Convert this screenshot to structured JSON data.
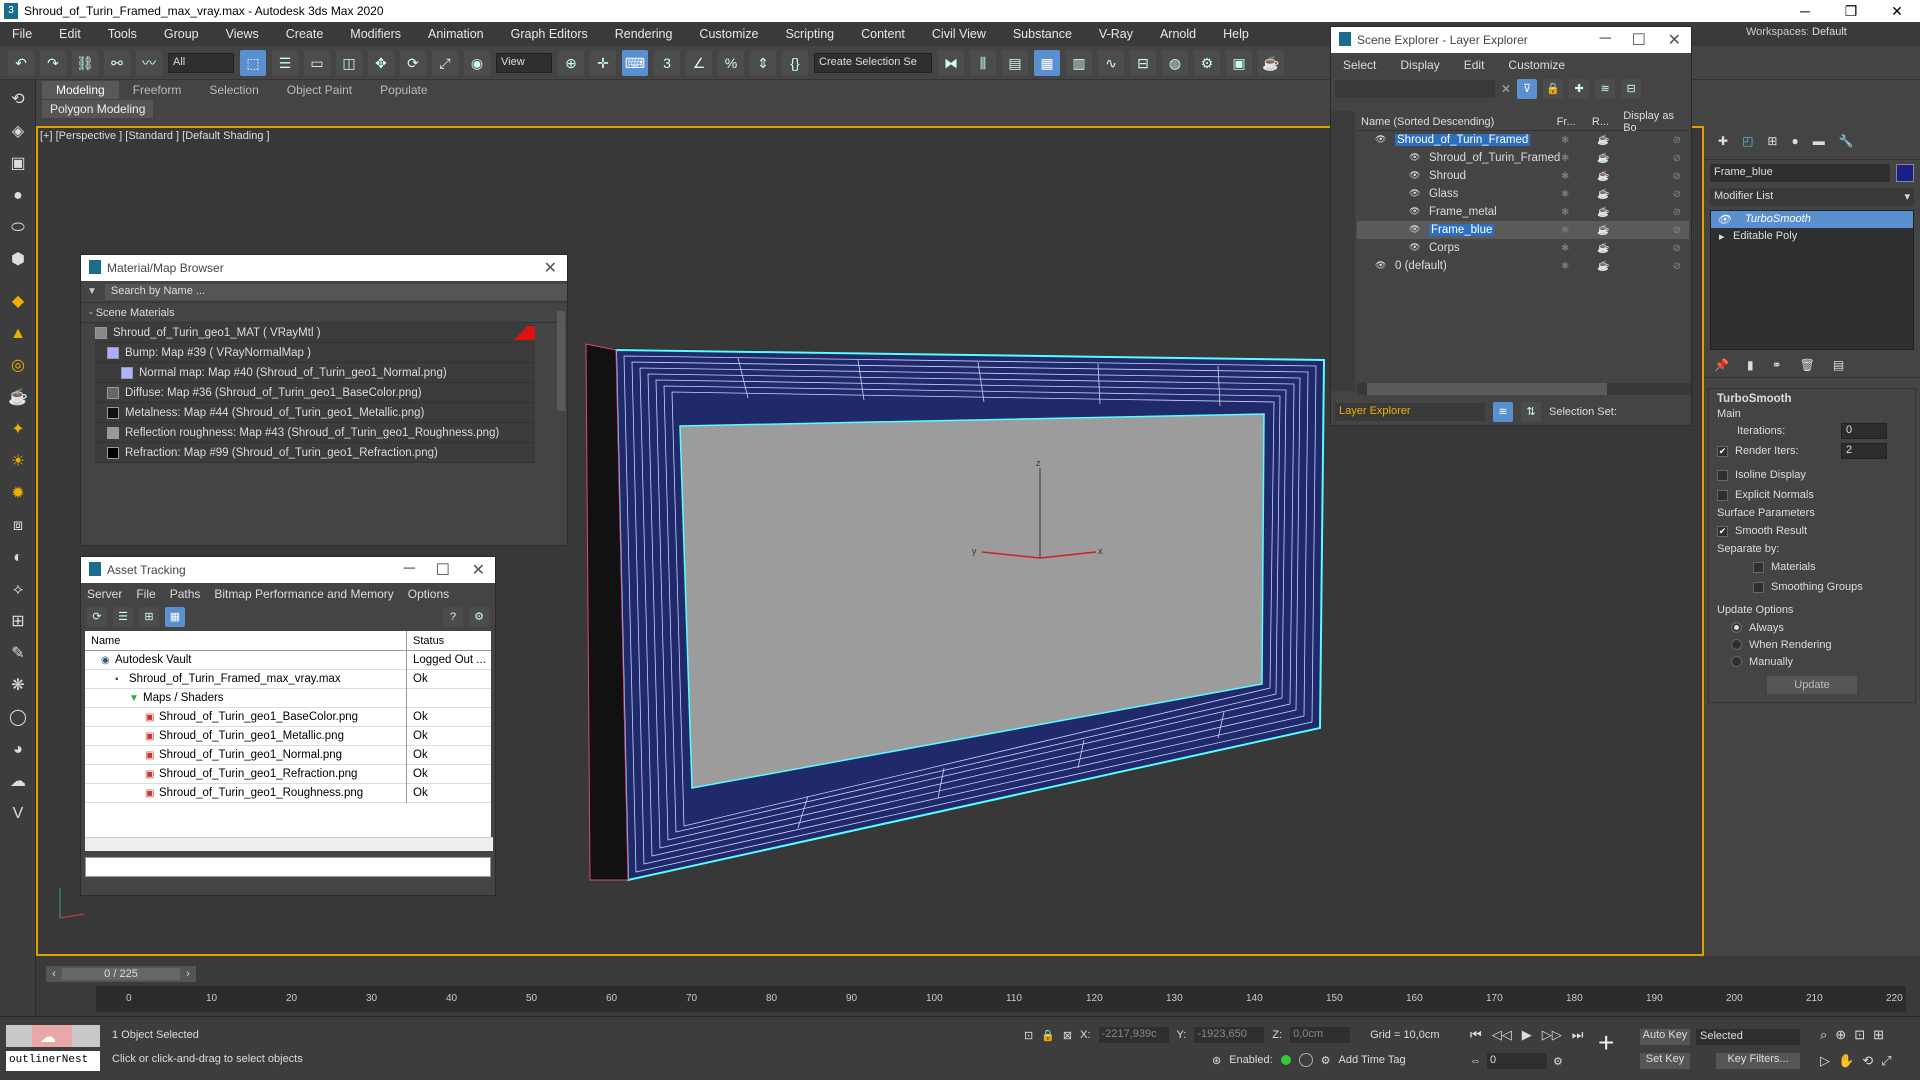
{
  "title": "Shroud_of_Turin_Framed_max_vray.max - Autodesk 3ds Max 2020",
  "workspaces_label": "Workspaces:",
  "workspaces_value": "Default",
  "menu": [
    "File",
    "Edit",
    "Tools",
    "Group",
    "Views",
    "Create",
    "Modifiers",
    "Animation",
    "Graph Editors",
    "Rendering",
    "Customize",
    "Scripting",
    "Content",
    "Civil View",
    "Substance",
    "V-Ray",
    "Arnold",
    "Help"
  ],
  "toolbar": {
    "filter": "All",
    "view": "View",
    "selection_set": "Create Selection Se"
  },
  "ribbon": {
    "tabs": [
      "Modeling",
      "Freeform",
      "Selection",
      "Object Paint",
      "Populate"
    ],
    "sub": "Polygon Modeling"
  },
  "viewport_label": "[+] [Perspective ] [Standard ] [Default Shading ]",
  "gizmo": {
    "z": "z",
    "x": "x",
    "y": "y"
  },
  "mat_browser": {
    "title": "Material/Map Browser",
    "search": "Search by Name ...",
    "section": "- Scene Materials",
    "items": [
      {
        "text": "Shroud_of_Turin_geo1_MAT  ( VRayMtl )",
        "swatch": "#888888"
      },
      {
        "text": "Bump: Map #39  ( VRayNormalMap )",
        "swatch": "#aab0ff"
      },
      {
        "text": "Normal map: Map #40 (Shroud_of_Turin_geo1_Normal.png)",
        "swatch": "#b0b4ff"
      },
      {
        "text": "Diffuse: Map #36 (Shroud_of_Turin_geo1_BaseColor.png)",
        "swatch": "#666666"
      },
      {
        "text": "Metalness: Map #44 (Shroud_of_Turin_geo1_Metallic.png)",
        "swatch": "#111111"
      },
      {
        "text": "Reflection roughness: Map #43 (Shroud_of_Turin_geo1_Roughness.png)",
        "swatch": "#999999"
      },
      {
        "text": "Refraction: Map #99 (Shroud_of_Turin_geo1_Refraction.png)",
        "swatch": "#000000"
      }
    ]
  },
  "asset_tracking": {
    "title": "Asset Tracking",
    "menu": [
      "Server",
      "File",
      "Paths",
      "Bitmap Performance and Memory",
      "Options"
    ],
    "col_name": "Name",
    "col_status": "Status",
    "rows": [
      {
        "name": "Autodesk Vault",
        "status": "Logged Out ..."
      },
      {
        "name": "Shroud_of_Turin_Framed_max_vray.max",
        "status": "Ok"
      },
      {
        "name": "Maps / Shaders",
        "status": ""
      },
      {
        "name": "Shroud_of_Turin_geo1_BaseColor.png",
        "status": "Ok"
      },
      {
        "name": "Shroud_of_Turin_geo1_Metallic.png",
        "status": "Ok"
      },
      {
        "name": "Shroud_of_Turin_geo1_Normal.png",
        "status": "Ok"
      },
      {
        "name": "Shroud_of_Turin_geo1_Refraction.png",
        "status": "Ok"
      },
      {
        "name": "Shroud_of_Turin_geo1_Roughness.png",
        "status": "Ok"
      }
    ]
  },
  "scene_explorer": {
    "title": "Scene Explorer - Layer Explorer",
    "menu": [
      "Select",
      "Display",
      "Edit",
      "Customize"
    ],
    "col_name": "Name (Sorted Descending)",
    "col_fr": "Fr...",
    "col_r": "R...",
    "col_display": "Display as Bo",
    "rows": [
      {
        "name": "Shroud_of_Turin_Framed",
        "hl": true
      },
      {
        "name": "Shroud_of_Turin_Framed",
        "hl": false
      },
      {
        "name": "Shroud",
        "hl": false
      },
      {
        "name": "Glass",
        "hl": false
      },
      {
        "name": "Frame_metal",
        "hl": false
      },
      {
        "name": "Frame_blue",
        "hl": true
      },
      {
        "name": "Corps",
        "hl": false
      },
      {
        "name": "0 (default)",
        "hl": false
      }
    ],
    "footer_left": "Layer Explorer",
    "footer_right": "Selection Set:"
  },
  "command_panel": {
    "object_name": "Frame_blue",
    "modifier_list": "Modifier List",
    "stack": [
      "TurboSmooth",
      "Editable Poly"
    ],
    "rollout": "TurboSmooth",
    "main": "Main",
    "iterations_label": "Iterations:",
    "iterations": "0",
    "render_iters_label": "Render Iters:",
    "render_iters": "2",
    "isoline": "Isoline Display",
    "explicit_normals": "Explicit Normals",
    "surface_params": "Surface Parameters",
    "smooth_result": "Smooth Result",
    "separate_by": "Separate by:",
    "materials": "Materials",
    "smoothing_groups": "Smoothing Groups",
    "update_options": "Update Options",
    "always": "Always",
    "when_rendering": "When Rendering",
    "manually": "Manually",
    "update_btn": "Update"
  },
  "timeline": {
    "frame": "0 / 225",
    "ticks": [
      "0",
      "10",
      "20",
      "30",
      "40",
      "50",
      "60",
      "70",
      "80",
      "90",
      "100",
      "110",
      "120",
      "130",
      "140",
      "150",
      "160",
      "170",
      "180",
      "190",
      "200",
      "210",
      "220"
    ]
  },
  "status": {
    "selected": "1 Object Selected",
    "hint": "Click or click-and-drag to select objects",
    "maxscript": "outlinerNest",
    "x_label": "X:",
    "x": "-2217,939c",
    "y_label": "Y:",
    "y": "-1923,650",
    "z_label": "Z:",
    "z": "0,0cm",
    "grid": "Grid = 10,0cm",
    "enabled": "Enabled:",
    "add_time_tag": "Add Time Tag",
    "auto_key": "Auto Key",
    "set_key": "Set Key",
    "selected_dd": "Selected",
    "key_filters": "Key Filters...",
    "frame_field": "0"
  }
}
